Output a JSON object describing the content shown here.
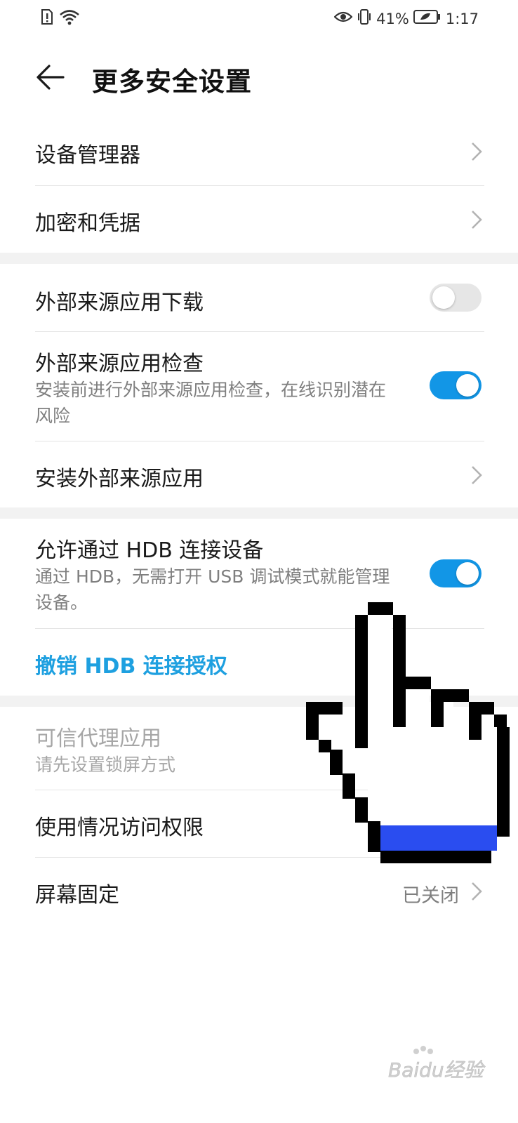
{
  "status_bar": {
    "battery_percent": "41%",
    "time": "1:17"
  },
  "header": {
    "title": "更多安全设置"
  },
  "section1": {
    "device_manager": "设备管理器",
    "encryption": "加密和凭据"
  },
  "section2": {
    "external_download": {
      "label": "外部来源应用下载",
      "enabled": false
    },
    "external_check": {
      "label": "外部来源应用检查",
      "description": "安装前进行外部来源应用检查，在线识别潜在风险",
      "enabled": true
    },
    "install_external": "安装外部来源应用"
  },
  "section3": {
    "hdb": {
      "label": "允许通过 HDB 连接设备",
      "description": "通过 HDB，无需打开 USB 调试模式就能管理设备。",
      "enabled": true
    },
    "revoke_hdb": "撤销 HDB 连接授权"
  },
  "section4": {
    "trust_agent": {
      "label": "可信代理应用",
      "description": "请先设置锁屏方式"
    },
    "usage_access": "使用情况访问权限",
    "screen_pinning": {
      "label": "屏幕固定",
      "value": "已关闭"
    }
  },
  "colors": {
    "accent": "#1296e6",
    "link": "#1ea0e0",
    "cursor_cuff": "#2a4df0"
  },
  "overlay": {
    "icon": "pointing-hand-cursor-icon"
  },
  "watermark": {
    "text": "Baidu经验"
  }
}
